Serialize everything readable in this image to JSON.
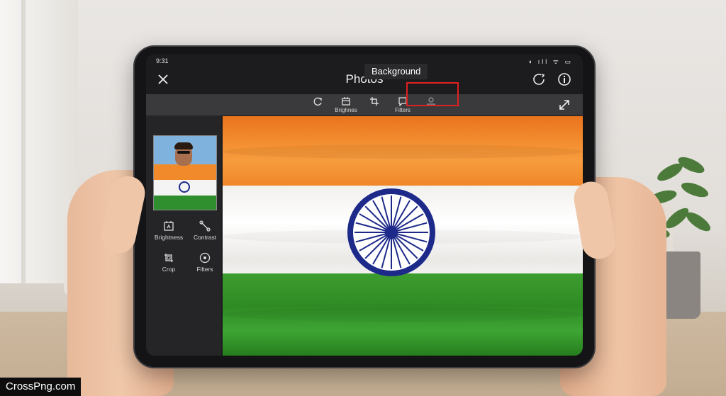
{
  "status": {
    "time": "9:31",
    "icons": "◖ ıll ᯤ ▭"
  },
  "header": {
    "title": "Photos"
  },
  "toolbar": {
    "tools": [
      {
        "label": "",
        "icon": "rotate-icon"
      },
      {
        "label": "Brighnes",
        "icon": "calendar-icon"
      },
      {
        "label": "",
        "icon": "crop-icon"
      },
      {
        "label": "Filters",
        "icon": "chat-icon"
      },
      {
        "label": "",
        "icon": "person-icon"
      }
    ],
    "expand_icon": "expand-arrows-icon"
  },
  "side_tools": [
    {
      "label": "Brightness",
      "icon": "brightness-icon"
    },
    {
      "label": "Contrast",
      "icon": "contrast-icon"
    },
    {
      "label": "Crop",
      "icon": "crop-icon"
    },
    {
      "label": "Filters",
      "icon": "filter-icon"
    }
  ],
  "tooltip": {
    "label": "Background"
  },
  "watermark": {
    "text": "CrossPng.com"
  },
  "colors": {
    "saffron": "#f48e30",
    "white": "#ffffff",
    "green": "#2f8a24",
    "navy": "#1d2a8a",
    "highlight": "#e02020"
  }
}
